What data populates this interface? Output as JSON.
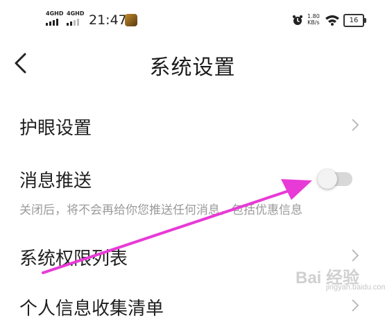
{
  "status_bar": {
    "network1": "4GHD",
    "network2": "4GHD",
    "time": "21:47",
    "speed_value": "1.80",
    "speed_unit": "KB/s",
    "battery": "16"
  },
  "header": {
    "title": "系统设置"
  },
  "rows": {
    "eye_care": "护眼设置",
    "push": "消息推送",
    "push_desc": "关闭后，将不会再给你您推送任何消息，包括优惠信息",
    "permissions": "系统权限列表",
    "info_collection": "个人信息收集清单"
  },
  "push_toggle": {
    "on": false
  },
  "watermark": {
    "text": "Bai 经验",
    "sub": "jingyan.baidu.com"
  },
  "colors": {
    "arrow": "#e83ad6",
    "toggle_track": "#d8d8d8",
    "subtext": "#9a9a9a"
  }
}
